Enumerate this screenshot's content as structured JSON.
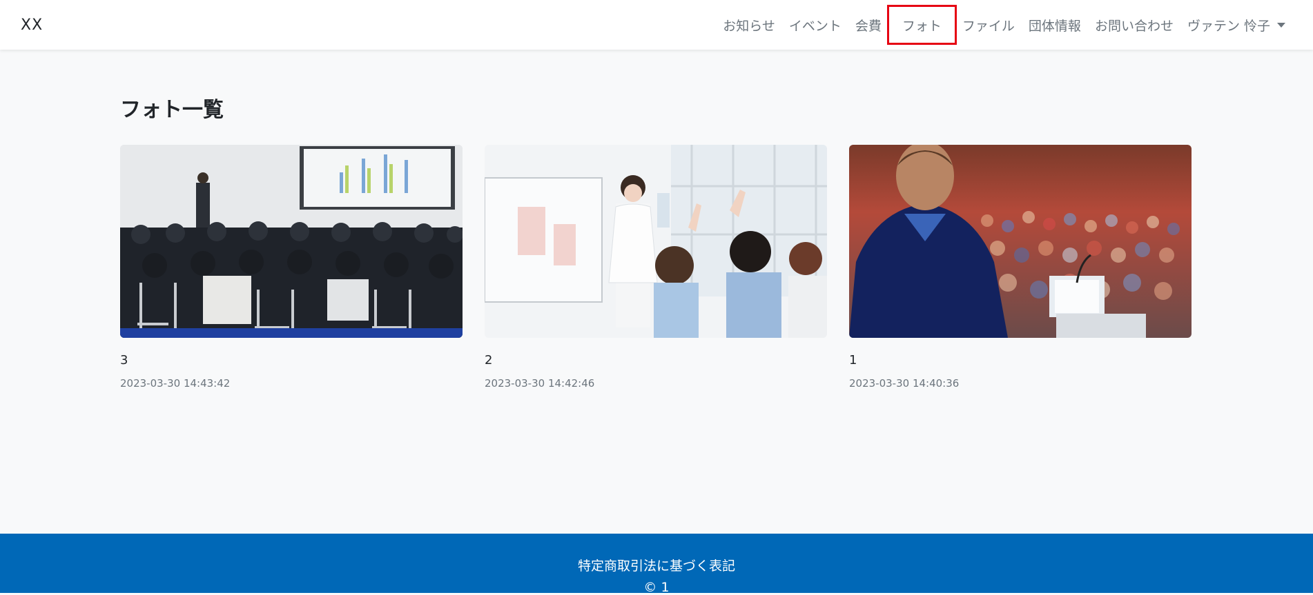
{
  "brand": "XX",
  "nav": {
    "items": [
      "お知らせ",
      "イベント",
      "会費",
      "フォト",
      "ファイル",
      "団体情報",
      "お問い合わせ"
    ],
    "user": "ヴァテン 怜子",
    "active": "フォト",
    "highlight_color": "#e60012"
  },
  "page": {
    "title": "フォト一覧"
  },
  "photos": [
    {
      "title": "3",
      "date": "2023-03-30 14:43:42",
      "image": "seminar-audience-photo"
    },
    {
      "title": "2",
      "date": "2023-03-30 14:42:46",
      "image": "medical-presentation-photo"
    },
    {
      "title": "1",
      "date": "2023-03-30 14:40:36",
      "image": "conference-speaker-photo"
    }
  ],
  "footer": {
    "link": "特定商取引法に基づく表記",
    "copyright": "© 1",
    "background": "#0068b7"
  }
}
